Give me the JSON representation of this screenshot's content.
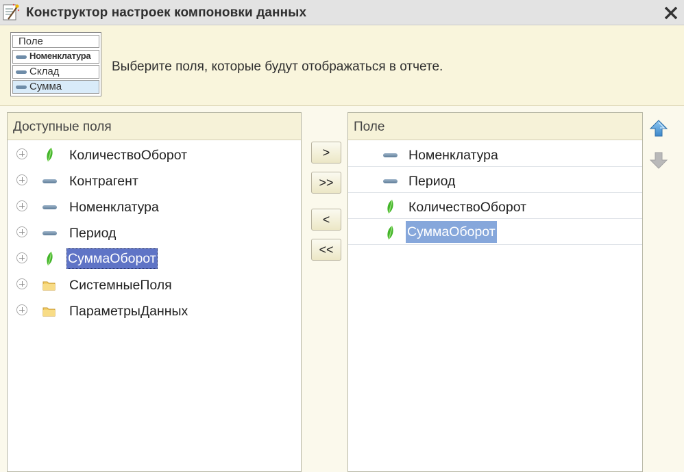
{
  "window": {
    "title": "Конструктор настроек компоновки данных"
  },
  "header": {
    "hint": "Выберите поля, которые будут отображаться в отчете.",
    "preview": {
      "rows": [
        "Поле",
        "Номенклатура",
        "Склад",
        "Сумма"
      ]
    }
  },
  "left_panel": {
    "title": "Доступные поля",
    "items": [
      {
        "label": "КоличествоОборот",
        "icon": "resource-leaf-icon"
      },
      {
        "label": "Контрагент",
        "icon": "field-dash-icon"
      },
      {
        "label": "Номенклатура",
        "icon": "field-dash-icon"
      },
      {
        "label": "Период",
        "icon": "field-dash-icon"
      },
      {
        "label": "СуммаОборот",
        "icon": "resource-leaf-icon",
        "selected": true
      },
      {
        "label": "СистемныеПоля",
        "icon": "folder-icon"
      },
      {
        "label": "ПараметрыДанных",
        "icon": "folder-icon"
      }
    ]
  },
  "buttons": {
    "add": ">",
    "add_all": ">>",
    "remove": "<",
    "remove_all": "<<"
  },
  "right_panel": {
    "title": "Поле",
    "items": [
      {
        "label": "Номенклатура",
        "icon": "field-dash-icon"
      },
      {
        "label": "Период",
        "icon": "field-dash-icon"
      },
      {
        "label": "КоличествоОборот",
        "icon": "resource-leaf-icon"
      },
      {
        "label": "СуммаОборот",
        "icon": "resource-leaf-icon",
        "selected": true
      }
    ]
  },
  "colors": {
    "selection_left": "#5f74c6",
    "selection_right": "#86a7db",
    "header_bg": "#f9f5dc",
    "titlebar_bg": "#e3e3e3"
  }
}
